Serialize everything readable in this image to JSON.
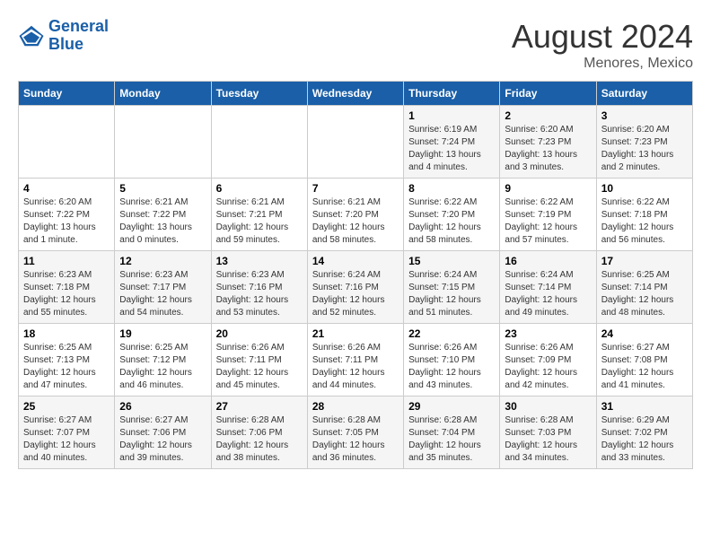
{
  "header": {
    "logo_line1": "General",
    "logo_line2": "Blue",
    "month": "August 2024",
    "location": "Menores, Mexico"
  },
  "weekdays": [
    "Sunday",
    "Monday",
    "Tuesday",
    "Wednesday",
    "Thursday",
    "Friday",
    "Saturday"
  ],
  "weeks": [
    [
      {
        "day": "",
        "text": ""
      },
      {
        "day": "",
        "text": ""
      },
      {
        "day": "",
        "text": ""
      },
      {
        "day": "",
        "text": ""
      },
      {
        "day": "1",
        "text": "Sunrise: 6:19 AM\nSunset: 7:24 PM\nDaylight: 13 hours and 4 minutes."
      },
      {
        "day": "2",
        "text": "Sunrise: 6:20 AM\nSunset: 7:23 PM\nDaylight: 13 hours and 3 minutes."
      },
      {
        "day": "3",
        "text": "Sunrise: 6:20 AM\nSunset: 7:23 PM\nDaylight: 13 hours and 2 minutes."
      }
    ],
    [
      {
        "day": "4",
        "text": "Sunrise: 6:20 AM\nSunset: 7:22 PM\nDaylight: 13 hours and 1 minute."
      },
      {
        "day": "5",
        "text": "Sunrise: 6:21 AM\nSunset: 7:22 PM\nDaylight: 13 hours and 0 minutes."
      },
      {
        "day": "6",
        "text": "Sunrise: 6:21 AM\nSunset: 7:21 PM\nDaylight: 12 hours and 59 minutes."
      },
      {
        "day": "7",
        "text": "Sunrise: 6:21 AM\nSunset: 7:20 PM\nDaylight: 12 hours and 58 minutes."
      },
      {
        "day": "8",
        "text": "Sunrise: 6:22 AM\nSunset: 7:20 PM\nDaylight: 12 hours and 58 minutes."
      },
      {
        "day": "9",
        "text": "Sunrise: 6:22 AM\nSunset: 7:19 PM\nDaylight: 12 hours and 57 minutes."
      },
      {
        "day": "10",
        "text": "Sunrise: 6:22 AM\nSunset: 7:18 PM\nDaylight: 12 hours and 56 minutes."
      }
    ],
    [
      {
        "day": "11",
        "text": "Sunrise: 6:23 AM\nSunset: 7:18 PM\nDaylight: 12 hours and 55 minutes."
      },
      {
        "day": "12",
        "text": "Sunrise: 6:23 AM\nSunset: 7:17 PM\nDaylight: 12 hours and 54 minutes."
      },
      {
        "day": "13",
        "text": "Sunrise: 6:23 AM\nSunset: 7:16 PM\nDaylight: 12 hours and 53 minutes."
      },
      {
        "day": "14",
        "text": "Sunrise: 6:24 AM\nSunset: 7:16 PM\nDaylight: 12 hours and 52 minutes."
      },
      {
        "day": "15",
        "text": "Sunrise: 6:24 AM\nSunset: 7:15 PM\nDaylight: 12 hours and 51 minutes."
      },
      {
        "day": "16",
        "text": "Sunrise: 6:24 AM\nSunset: 7:14 PM\nDaylight: 12 hours and 49 minutes."
      },
      {
        "day": "17",
        "text": "Sunrise: 6:25 AM\nSunset: 7:14 PM\nDaylight: 12 hours and 48 minutes."
      }
    ],
    [
      {
        "day": "18",
        "text": "Sunrise: 6:25 AM\nSunset: 7:13 PM\nDaylight: 12 hours and 47 minutes."
      },
      {
        "day": "19",
        "text": "Sunrise: 6:25 AM\nSunset: 7:12 PM\nDaylight: 12 hours and 46 minutes."
      },
      {
        "day": "20",
        "text": "Sunrise: 6:26 AM\nSunset: 7:11 PM\nDaylight: 12 hours and 45 minutes."
      },
      {
        "day": "21",
        "text": "Sunrise: 6:26 AM\nSunset: 7:11 PM\nDaylight: 12 hours and 44 minutes."
      },
      {
        "day": "22",
        "text": "Sunrise: 6:26 AM\nSunset: 7:10 PM\nDaylight: 12 hours and 43 minutes."
      },
      {
        "day": "23",
        "text": "Sunrise: 6:26 AM\nSunset: 7:09 PM\nDaylight: 12 hours and 42 minutes."
      },
      {
        "day": "24",
        "text": "Sunrise: 6:27 AM\nSunset: 7:08 PM\nDaylight: 12 hours and 41 minutes."
      }
    ],
    [
      {
        "day": "25",
        "text": "Sunrise: 6:27 AM\nSunset: 7:07 PM\nDaylight: 12 hours and 40 minutes."
      },
      {
        "day": "26",
        "text": "Sunrise: 6:27 AM\nSunset: 7:06 PM\nDaylight: 12 hours and 39 minutes."
      },
      {
        "day": "27",
        "text": "Sunrise: 6:28 AM\nSunset: 7:06 PM\nDaylight: 12 hours and 38 minutes."
      },
      {
        "day": "28",
        "text": "Sunrise: 6:28 AM\nSunset: 7:05 PM\nDaylight: 12 hours and 36 minutes."
      },
      {
        "day": "29",
        "text": "Sunrise: 6:28 AM\nSunset: 7:04 PM\nDaylight: 12 hours and 35 minutes."
      },
      {
        "day": "30",
        "text": "Sunrise: 6:28 AM\nSunset: 7:03 PM\nDaylight: 12 hours and 34 minutes."
      },
      {
        "day": "31",
        "text": "Sunrise: 6:29 AM\nSunset: 7:02 PM\nDaylight: 12 hours and 33 minutes."
      }
    ]
  ]
}
